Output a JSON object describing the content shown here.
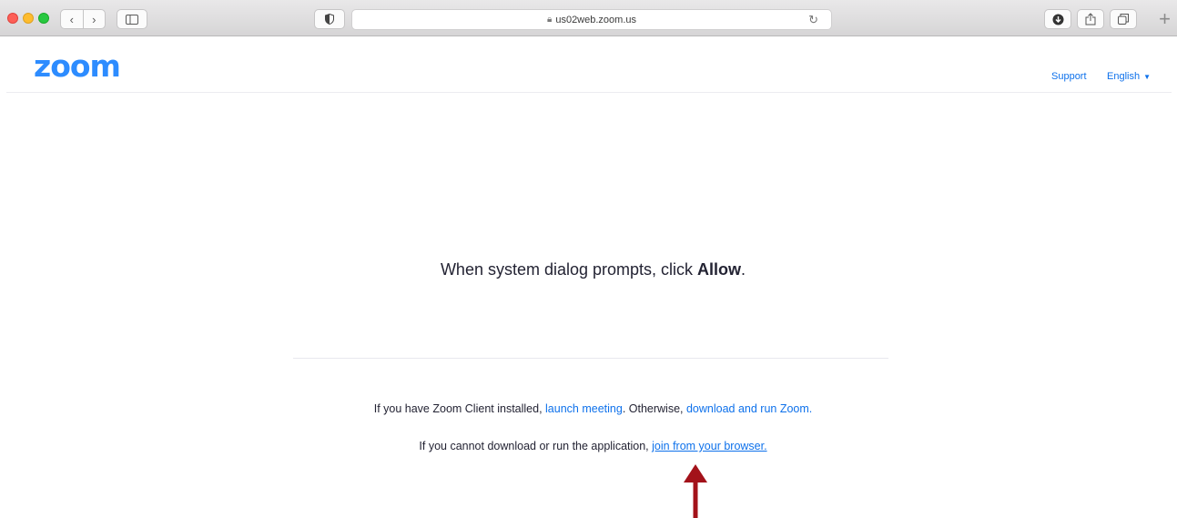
{
  "browser": {
    "url": "us02web.zoom.us",
    "icons": {
      "back": "chevron-left-icon",
      "forward": "chevron-right-icon",
      "sidebar": "sidebar-icon",
      "privacy": "shield-icon",
      "lock": "lock-icon",
      "reload": "reload-icon",
      "download": "download-icon",
      "share": "share-icon",
      "tabs": "tabs-overview-icon",
      "new_tab": "plus-icon"
    }
  },
  "header": {
    "logo": "zoom",
    "support": "Support",
    "language": "English"
  },
  "main": {
    "prompt_prefix": "When system dialog prompts, click ",
    "prompt_bold": "Allow",
    "prompt_suffix": ".",
    "line1": {
      "prefix": "If you have Zoom Client installed, ",
      "launch_link": "launch meeting",
      "middle": ". Otherwise, ",
      "download_link": "download and run Zoom."
    },
    "line2": {
      "prefix": "If you cannot download or run the application, ",
      "browser_link": "join from your browser."
    }
  },
  "colors": {
    "brand": "#2d8cff",
    "link": "#0e71eb",
    "text": "#232333",
    "annotation_arrow": "#a3121a"
  }
}
